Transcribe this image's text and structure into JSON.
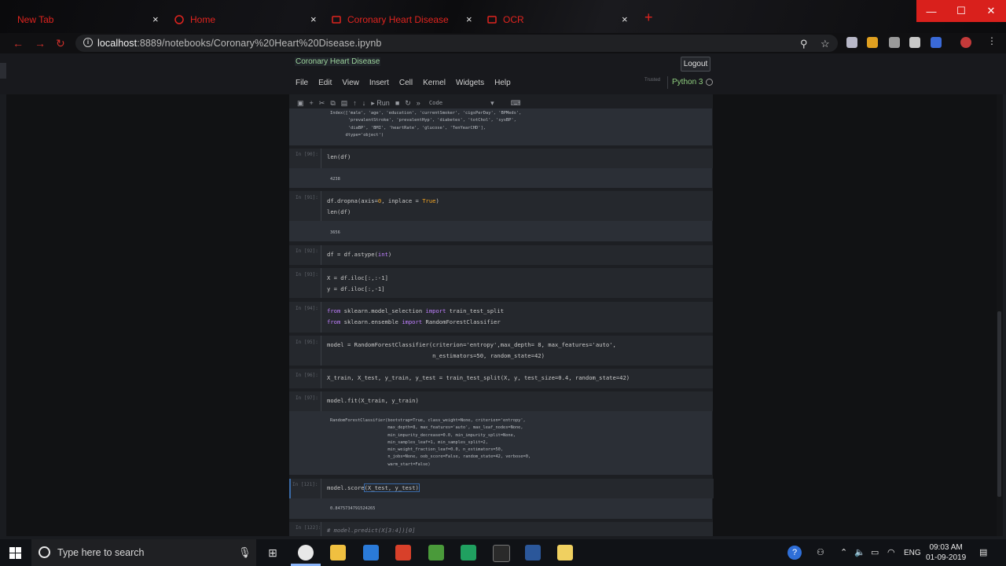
{
  "browser": {
    "tabs": [
      {
        "label": "New Tab"
      },
      {
        "label": "Home"
      },
      {
        "label": "Coronary Heart Disease"
      },
      {
        "label": "OCR"
      }
    ],
    "close_glyph": "×",
    "new_tab_glyph": "+",
    "url_host": "localhost",
    "url_rest": ":8889/notebooks/Coronary%20Heart%20Disease.ipynb",
    "window_controls": {
      "minimize": "—",
      "maximize": "☐",
      "close": "✕"
    }
  },
  "jupyter": {
    "notebook_title": "Coronary Heart Disease",
    "logout_label": "Logout",
    "menus": [
      "File",
      "Edit",
      "View",
      "Insert",
      "Cell",
      "Kernel",
      "Widgets",
      "Help"
    ],
    "trusted_label": "Trusted",
    "kernel_name": "Python 3",
    "toolbar": {
      "run_label": "▸ Run",
      "cell_type": "Code"
    }
  },
  "cells": {
    "c0_out": "Index(['male', 'age', 'education', 'currentSmoker', 'cigsPerDay', 'BPMeds',\n       'prevalentStroke', 'prevalentHyp', 'diabetes', 'totChol', 'sysBP',\n       'diaBP', 'BMI', 'heartRate', 'glucose', 'TenYearCHD'],\n      dtype='object')",
    "c1_prompt": "In [90]:",
    "c1_code": "len(df)",
    "c1_out": "4238",
    "c2_prompt": "In [91]:",
    "c2_code_a": "df.dropna(axis=",
    "c2_code_b": "0",
    "c2_code_c": ", inplace = ",
    "c2_code_d": "True",
    "c2_code_e": ")",
    "c2_code_line2": "len(df)",
    "c2_out": "3656",
    "c3_prompt": "In [92]:",
    "c3_code_a": "df = df.astype(",
    "c3_code_b": "int",
    "c3_code_c": ")",
    "c4_prompt": "In [93]:",
    "c4_line1": "X = df.iloc[:,:-1]",
    "c4_line2": "y = df.iloc[:,-1]",
    "c5_prompt": "In [94]:",
    "c5_kw1": "from",
    "c5_mod1": " sklearn.model_selection ",
    "c5_kw2": "import",
    "c5_name1": " train_test_split",
    "c5_kw3": "from",
    "c5_mod2": " sklearn.ensemble ",
    "c5_kw4": "import",
    "c5_name2": " RandomForestClassifier",
    "c6_prompt": "In [95]:",
    "c6_line1": "model = RandomForestClassifier(criterion='entropy',max_depth= 8, max_features='auto',",
    "c6_line2": "                               n_estimators=50, random_state=42)",
    "c7_prompt": "In [96]:",
    "c7_code": "X_train, X_test, y_train, y_test = train_test_split(X, y, test_size=0.4, random_state=42)",
    "c8_prompt": "In [97]:",
    "c8_code": "model.fit(X_train, y_train)",
    "c8_out": "RandomForestClassifier(bootstrap=True, class_weight=None, criterion='entropy',\n                       max_depth=8, max_features='auto', max_leaf_nodes=None,\n                       min_impurity_decrease=0.0, min_impurity_split=None,\n                       min_samples_leaf=1, min_samples_split=2,\n                       min_weight_fraction_leaf=0.0, n_estimators=50,\n                       n_jobs=None, oob_score=False, random_state=42, verbose=0,\n                       warm_start=False)",
    "c9_prompt": "In [121]:",
    "c9_code_a": "model.score",
    "c9_code_b": "(X_test, y_test)",
    "c9_out": "0.8475734791524265",
    "c10_prompt": "In [122]:",
    "c10_code": "# model.predict(X[3:4])[0]"
  },
  "taskbar": {
    "search_placeholder": "Type here to search",
    "language": "ENG",
    "time": "09:03 AM",
    "date": "01-09-2019"
  }
}
